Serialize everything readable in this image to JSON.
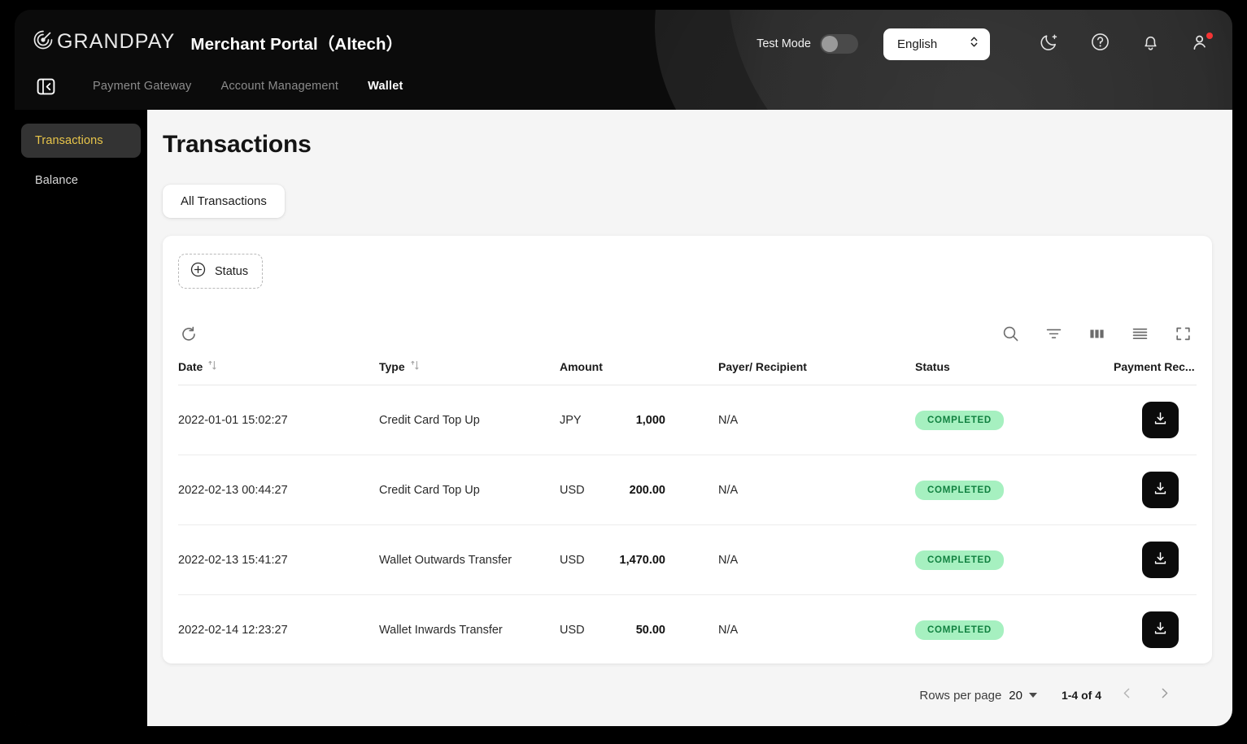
{
  "header": {
    "logo_text": "GRANDPAY",
    "logo_icon": "grandpay-target-logo",
    "portal_title": "Merchant Portal（Altech）",
    "collapse_icon": "sidebar-collapse-icon",
    "nav": [
      {
        "label": "Payment Gateway",
        "active": false
      },
      {
        "label": "Account Management",
        "active": false
      },
      {
        "label": "Wallet",
        "active": true
      }
    ],
    "test_mode_label": "Test Mode",
    "test_mode_on": false,
    "language": "English",
    "icons": {
      "theme": "moon-icon",
      "help": "question-circle-icon",
      "notifications": "bell-icon",
      "account": "user-avatar-icon"
    },
    "notification_dot": true
  },
  "sidebar": {
    "items": [
      {
        "label": "Transactions",
        "active": true
      },
      {
        "label": "Balance",
        "active": false
      }
    ],
    "active_color": "#e8c54a"
  },
  "main": {
    "page_title": "Transactions",
    "tabs": [
      {
        "label": "All Transactions",
        "active": true
      }
    ],
    "filters": {
      "status_label": "Status",
      "status_icon": "plus-circle-icon"
    },
    "toolbar": {
      "refresh_icon": "refresh-icon",
      "search_icon": "search-icon",
      "filter_icon": "filter-icon",
      "columns_icon": "columns-icon",
      "density_icon": "density-list-icon",
      "fullscreen_icon": "fullscreen-icon"
    },
    "table": {
      "columns": [
        {
          "key": "date",
          "label": "Date",
          "sortable": true
        },
        {
          "key": "type",
          "label": "Type",
          "sortable": true
        },
        {
          "key": "amount",
          "label": "Amount",
          "sortable": false
        },
        {
          "key": "payer",
          "label": "Payer/ Recipient",
          "sortable": false
        },
        {
          "key": "status",
          "label": "Status",
          "sortable": false
        },
        {
          "key": "receipt",
          "label": "Payment Rec...",
          "sortable": false
        }
      ],
      "rows": [
        {
          "date": "2022-01-01 15:02:27",
          "type": "Credit Card Top Up",
          "currency": "JPY",
          "amount": "1,000",
          "payer": "N/A",
          "status": "COMPLETED",
          "receipt_icon": "download-icon"
        },
        {
          "date": "2022-02-13 00:44:27",
          "type": "Credit Card Top Up",
          "currency": "USD",
          "amount": "200.00",
          "payer": "N/A",
          "status": "COMPLETED",
          "receipt_icon": "download-icon"
        },
        {
          "date": "2022-02-13 15:41:27",
          "type": "Wallet Outwards Transfer",
          "currency": "USD",
          "amount": "1,470.00",
          "payer": "N/A",
          "status": "COMPLETED",
          "receipt_icon": "download-icon"
        },
        {
          "date": "2022-02-14 12:23:27",
          "type": "Wallet Inwards Transfer",
          "currency": "USD",
          "amount": "50.00",
          "payer": "N/A",
          "status": "COMPLETED",
          "receipt_icon": "download-icon"
        }
      ]
    },
    "pagination": {
      "rows_per_page_label": "Rows per page",
      "rows_per_page_value": "20",
      "range": "1-4 of 4",
      "prev_icon": "chevron-left-icon",
      "next_icon": "chevron-right-icon"
    }
  },
  "colors": {
    "header_bg": "#0b0b0b",
    "sidebar_bg": "#000000",
    "content_bg": "#f5f5f5",
    "accent_yellow": "#e8c54a",
    "badge_bg": "#a6f0c0",
    "badge_text": "#118140",
    "notification_dot": "#f43434"
  }
}
